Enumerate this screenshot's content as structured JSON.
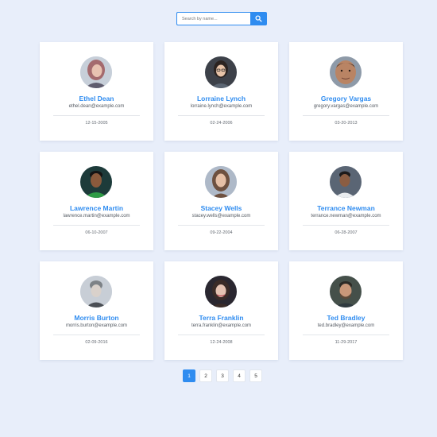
{
  "search": {
    "placeholder": "Search by name...",
    "value": ""
  },
  "colors": {
    "accent": "#2f8cf0",
    "background": "#e8eefa"
  },
  "users": [
    {
      "name": "Ethel Dean",
      "email": "ethel.dean@example.com",
      "date": "12-15-2005"
    },
    {
      "name": "Lorraine Lynch",
      "email": "lorraine.lynch@example.com",
      "date": "02-24-2006"
    },
    {
      "name": "Gregory Vargas",
      "email": "gregory.vargas@example.com",
      "date": "03-20-2013"
    },
    {
      "name": "Lawrence Martin",
      "email": "lawrence.martin@example.com",
      "date": "06-10-2007"
    },
    {
      "name": "Stacey Wells",
      "email": "stacey.wells@example.com",
      "date": "09-22-2004"
    },
    {
      "name": "Terrance Newman",
      "email": "terrance.newman@example.com",
      "date": "06-28-2007"
    },
    {
      "name": "Morris Burton",
      "email": "morris.burton@example.com",
      "date": "02-09-2016"
    },
    {
      "name": "Terra Franklin",
      "email": "terra.franklin@example.com",
      "date": "12-24-2008"
    },
    {
      "name": "Ted Bradley",
      "email": "ted.bradley@example.com",
      "date": "11-29-2017"
    }
  ],
  "pagination": {
    "pages": [
      "1",
      "2",
      "3",
      "4",
      "5"
    ],
    "current": "1"
  }
}
